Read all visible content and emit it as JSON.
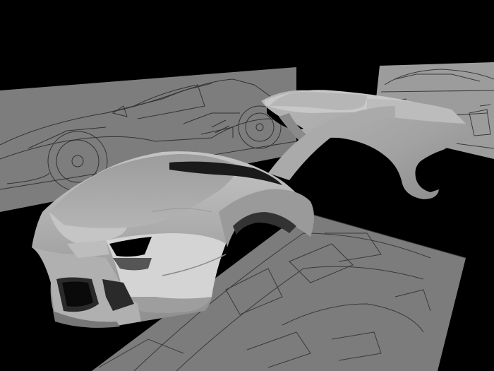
{
  "viewport": {
    "background": "#000000",
    "plane_fill": "#7c7c7c",
    "plane_fill_light": "#9a9a9a",
    "blueprint_line": "#3a3a3a",
    "body_fill": "#a6a6a6",
    "body_highlight": "#c9c9c9",
    "body_shadow": "#6e6e6e"
  },
  "objects": [
    {
      "name": "side-view-reference-plane"
    },
    {
      "name": "rear-view-reference-plane"
    },
    {
      "name": "top-view-reference-plane"
    },
    {
      "name": "car-body-mesh"
    }
  ]
}
